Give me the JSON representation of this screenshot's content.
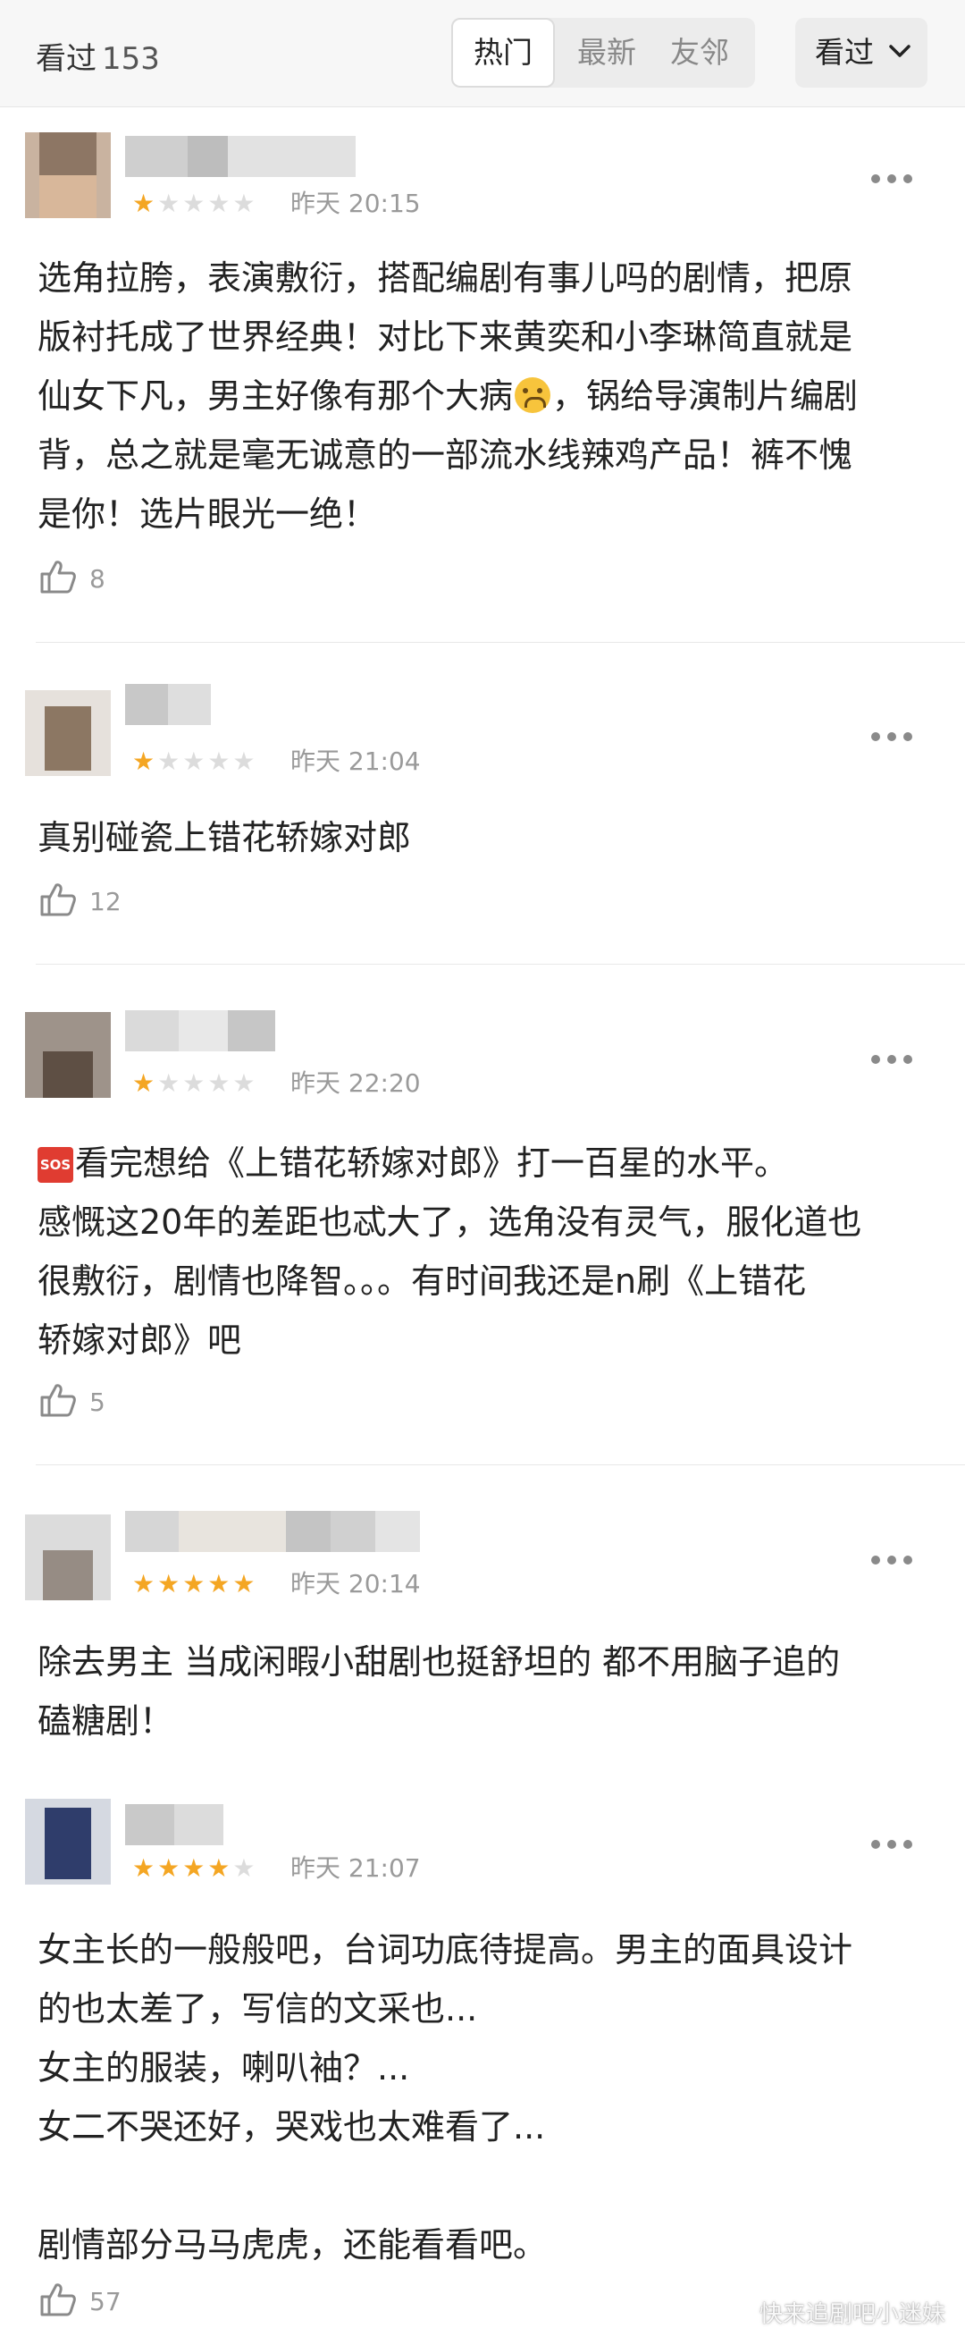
{
  "header": {
    "count_label": "看过",
    "count_value": "153",
    "tabs": [
      {
        "label": "热门",
        "active": true
      },
      {
        "label": "最新",
        "active": false
      },
      {
        "label": "友邻",
        "active": false
      }
    ],
    "filter_label": "看过"
  },
  "colors": {
    "star_on": "#f4a623",
    "star_off": "#dcdcdc",
    "meta_text": "#9a9a9a"
  },
  "comments": [
    {
      "rating": 1,
      "time": "昨天 20:15",
      "lines": [
        "选角拉胯，表演敷衍，搭配编剧有事儿吗的剧情，把原",
        "版衬托成了世界经典！对比下来黄奕和小李琳简直就是",
        "仙女下凡，男主好像有那个大病",
        "，锅给导演制片编剧",
        "背，总之就是毫无诚意的一部流水线辣鸡产品！裤不愧",
        "是你！选片眼光一绝！"
      ],
      "likes": "8"
    },
    {
      "rating": 1,
      "time": "昨天 21:04",
      "lines": [
        "真别碰瓷上错花轿嫁对郎"
      ],
      "likes": "12"
    },
    {
      "rating": 1,
      "time": "昨天 22:20",
      "lines": [
        "看完想给《上错花轿嫁对郎》打一百星的水平。",
        "感慨这20年的差距也忒大了，选角没有灵气，服化道也",
        "很敷衍，剧情也降智。。。有时间我还是n刷《上错花",
        "轿嫁对郎》吧"
      ],
      "likes": "5"
    },
    {
      "rating": 5,
      "time": "昨天 20:14",
      "lines": [
        "除去男主 当成闲暇小甜剧也挺舒坦的 都不用脑子追的",
        "磕糖剧！"
      ],
      "likes": ""
    },
    {
      "rating": 4,
      "time": "昨天 21:07",
      "lines": [
        "女主长的一般般吧，台词功底待提高。男主的面具设计",
        "的也太差了，写信的文采也...",
        "女主的服装，喇叭袖？...",
        "女二不哭还好，哭戏也太难看了...",
        "",
        "剧情部分马马虎虎，还能看看吧。"
      ],
      "likes": "57"
    }
  ],
  "icons": {
    "more": "more-dots-icon",
    "like": "thumbs-up-icon",
    "emoji": "upside-down-face-emoji-icon",
    "sos": "sos-emoji-icon",
    "filter_chevron": "chevron-down-icon"
  },
  "sos_text": "SOS",
  "watermark": "快来追剧吧小迷妹"
}
